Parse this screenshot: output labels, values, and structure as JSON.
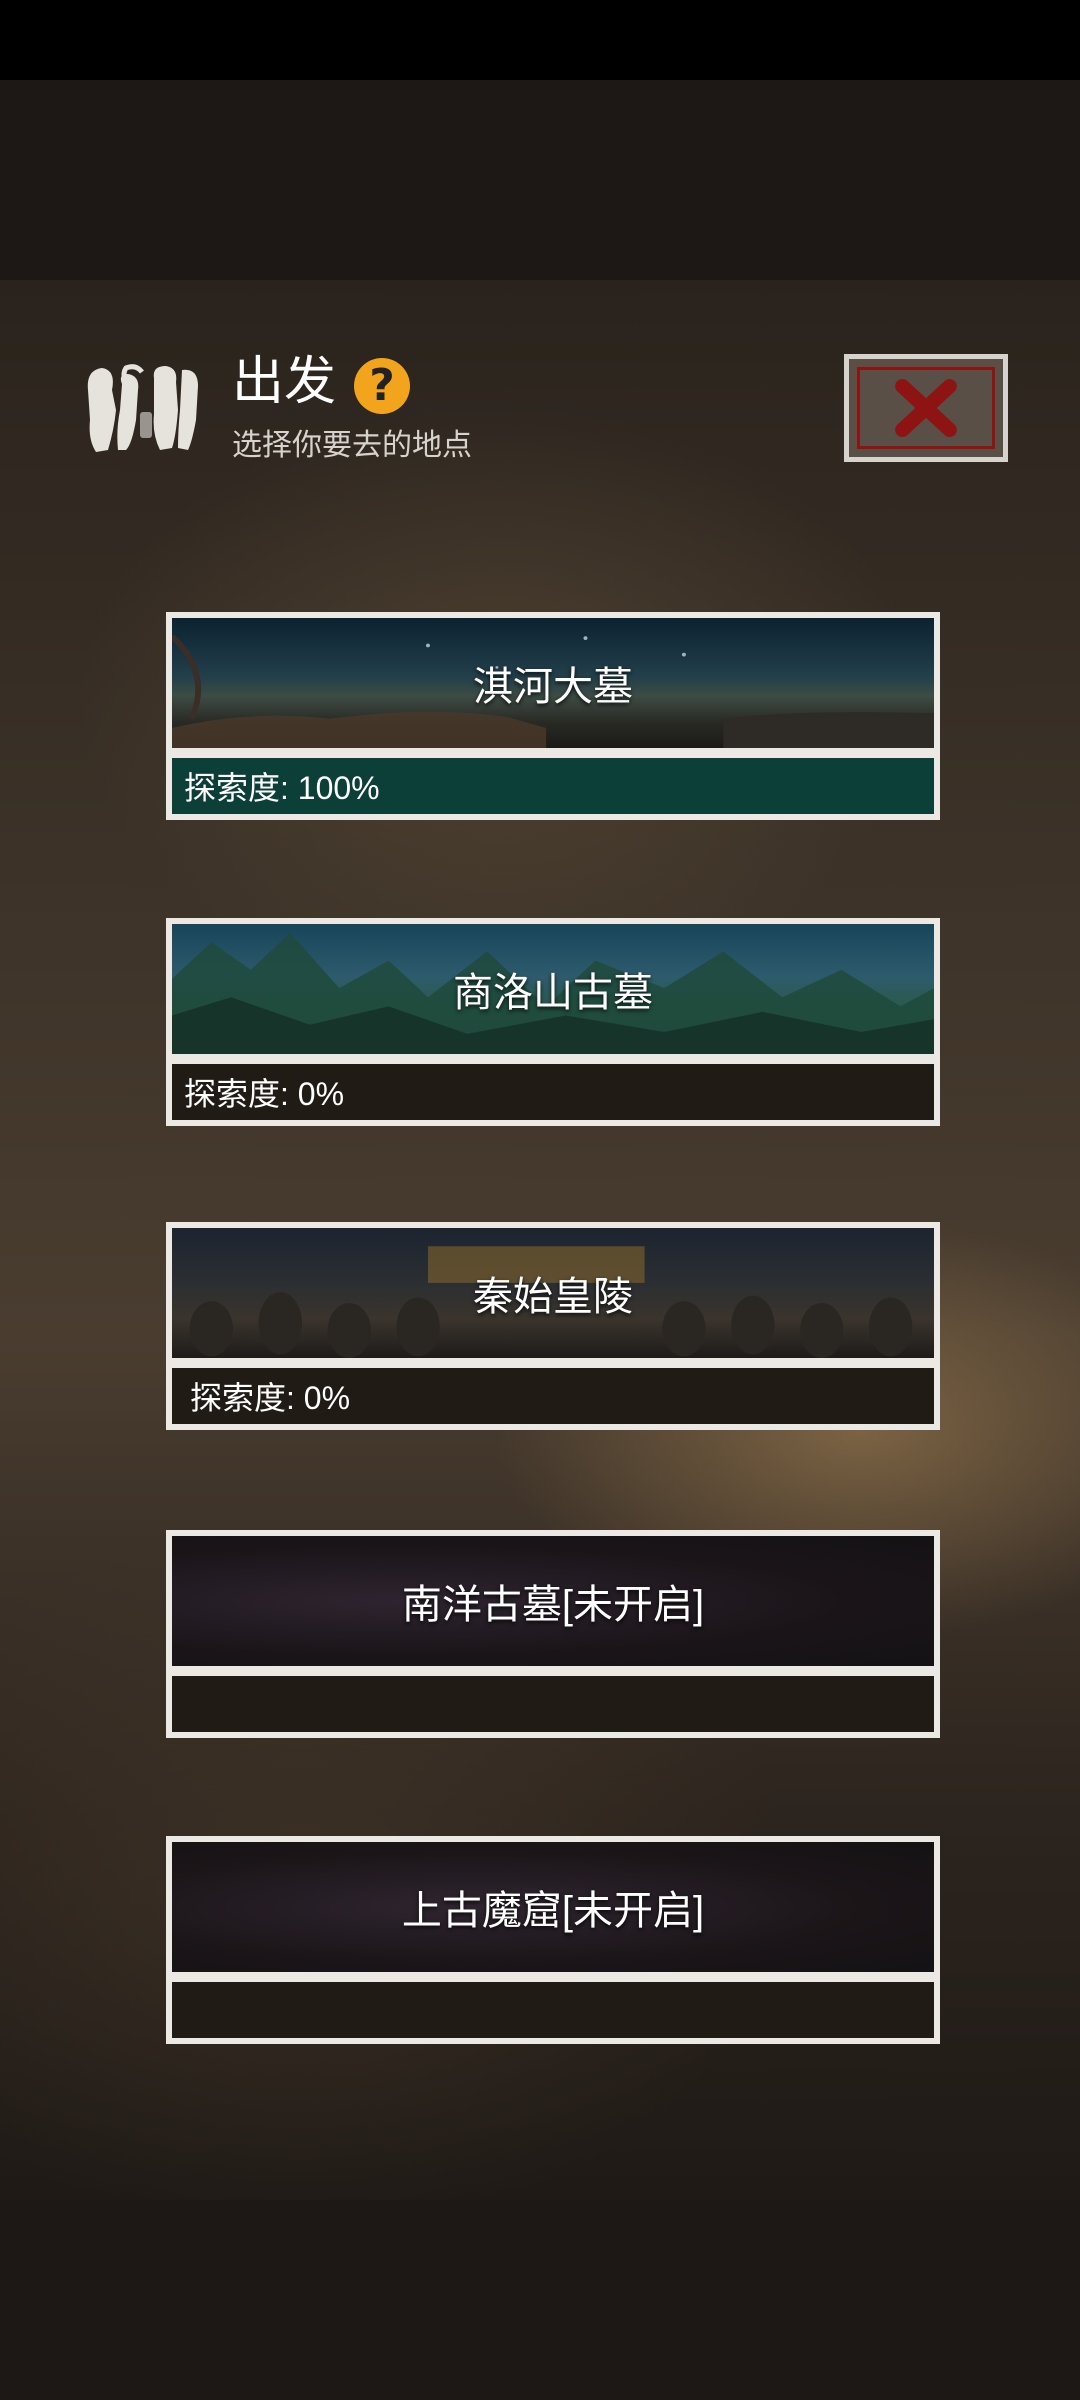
{
  "header": {
    "title": "出发",
    "help_label": "?",
    "subtitle": "选择你要去的地点"
  },
  "locations": [
    {
      "name": "淇河大墓",
      "progress_text": "探索度: 100%",
      "progress": 1.0,
      "locked": false
    },
    {
      "name": "商洛山古墓",
      "progress_text": "探索度: 0%",
      "progress": 0.0,
      "locked": false
    },
    {
      "name": "秦始皇陵",
      "progress_text": "探索度: 0%",
      "progress": 0.0,
      "locked": false
    },
    {
      "name": "南洋古墓[未开启]",
      "progress_text": "",
      "progress": 0.0,
      "locked": true
    },
    {
      "name": "上古魔窟[未开启]",
      "progress_text": "",
      "progress": 0.0,
      "locked": true
    }
  ],
  "colors": {
    "progress_fill": "#0d3f39",
    "help_badge": "#f2a51c",
    "close_x": "#8e1414"
  },
  "icons": {
    "header": "footprints-icon",
    "help": "question-icon",
    "close": "close-icon"
  }
}
